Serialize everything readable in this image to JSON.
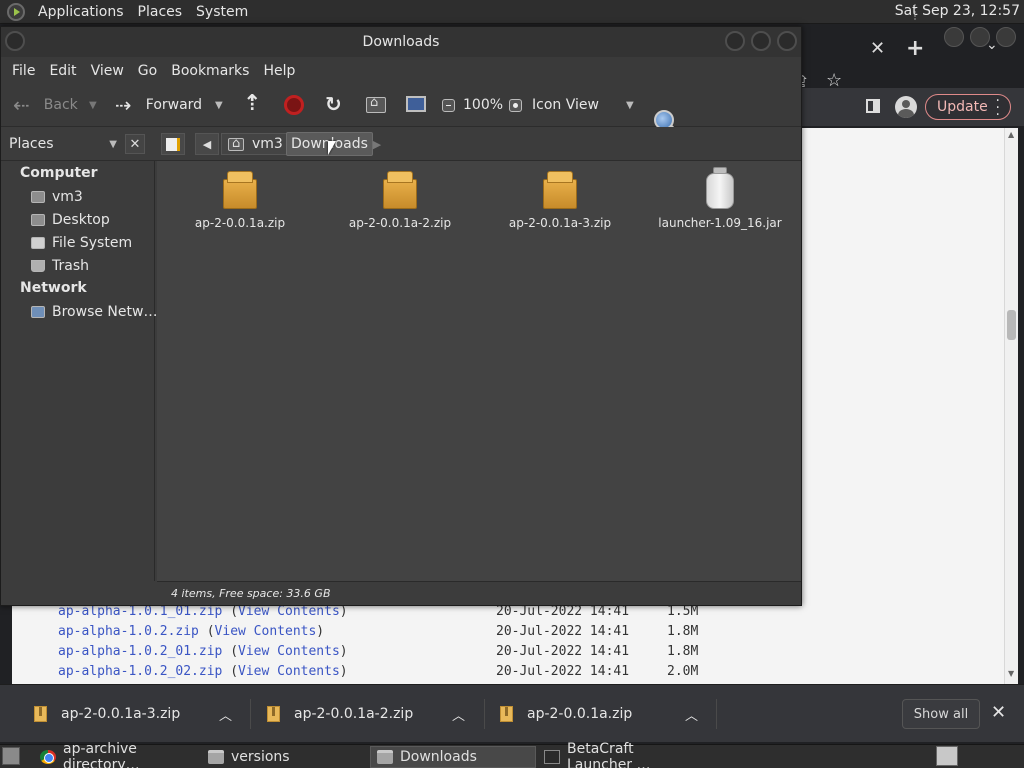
{
  "top_panel": {
    "menus": [
      "Applications",
      "Places",
      "System"
    ],
    "clock": "Sat Sep 23, 12:57"
  },
  "browser": {
    "update_label": "Update",
    "listing": [
      {
        "file": "ap-alpha-1.0.1_01.zip",
        "contents_label": "View Contents",
        "date": "20-Jul-2022 14:41",
        "size": "1.5M"
      },
      {
        "file": "ap-alpha-1.0.2.zip",
        "contents_label": "View Contents",
        "date": "20-Jul-2022 14:41",
        "size": "1.8M"
      },
      {
        "file": "ap-alpha-1.0.2_01.zip",
        "contents_label": "View Contents",
        "date": "20-Jul-2022 14:41",
        "size": "1.8M"
      },
      {
        "file": "ap-alpha-1.0.2_02.zip",
        "contents_label": "View Contents",
        "date": "20-Jul-2022 14:41",
        "size": "2.0M"
      }
    ],
    "downloads": [
      "ap-2-0.0.1a-3.zip",
      "ap-2-0.0.1a-2.zip",
      "ap-2-0.0.1a.zip"
    ],
    "show_all_label": "Show all"
  },
  "file_manager": {
    "title": "Downloads",
    "menus": [
      "File",
      "Edit",
      "View",
      "Go",
      "Bookmarks",
      "Help"
    ],
    "toolbar": {
      "back_label": "Back",
      "forward_label": "Forward",
      "zoom": "100%",
      "view_mode": "Icon View"
    },
    "pathbar": {
      "pane_label": "Places",
      "home_crumb": "vm3",
      "current_crumb": "Downloads"
    },
    "sidebar": {
      "computer_header": "Computer",
      "computer_items": [
        "vm3",
        "Desktop",
        "File System",
        "Trash"
      ],
      "network_header": "Network",
      "network_items": [
        "Browse Netw…"
      ]
    },
    "files": [
      {
        "name": "ap-2-0.0.1a.zip",
        "icon": "zip-archive-icon"
      },
      {
        "name": "ap-2-0.0.1a-2.zip",
        "icon": "zip-archive-icon"
      },
      {
        "name": "ap-2-0.0.1a-3.zip",
        "icon": "zip-archive-icon"
      },
      {
        "name": "launcher-1.09_16.jar",
        "icon": "jar-icon"
      }
    ],
    "status": "4 items, Free space: 33.6 GB"
  },
  "taskbar": {
    "tasks": [
      "ap-archive directory…",
      "versions",
      "Downloads",
      "BetaCraft Launcher …"
    ]
  }
}
